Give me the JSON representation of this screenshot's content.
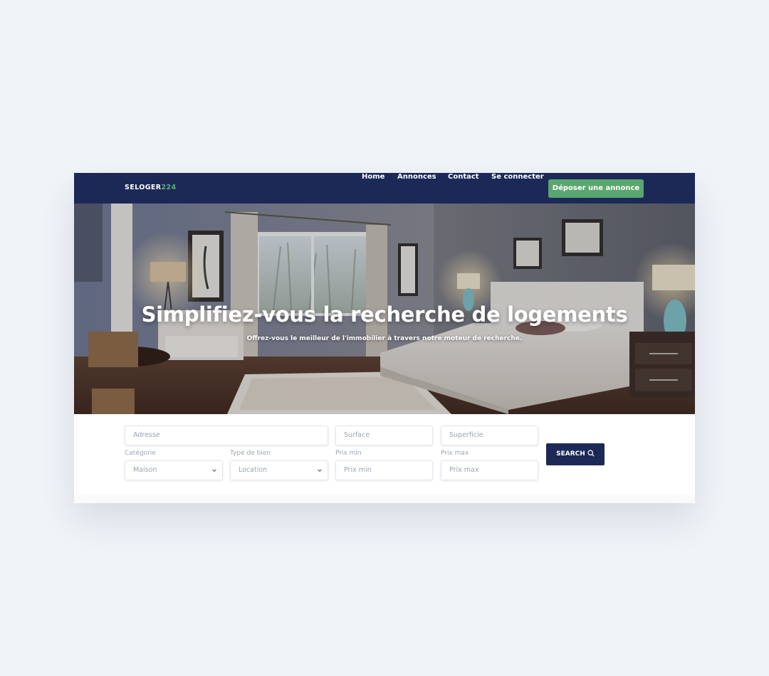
{
  "nav": {
    "logo_main": "SELOGER",
    "logo_accent": "224",
    "links": [
      "Home",
      "Annonces",
      "Contact",
      "Se connecter"
    ],
    "cta_label": "Déposer une annonce"
  },
  "hero": {
    "title": "Simplifiez-vous la recherche de logements",
    "subtitle": "Offrez-vous le meilleur de l'immobilier à travers notre moteur de recherche."
  },
  "search": {
    "address_placeholder": "Adresse",
    "surface_placeholder": "Surface",
    "superficie_placeholder": "Superficie",
    "category_label": "Catégorie",
    "category_value": "Maison",
    "type_label": "Type de bien",
    "type_value": "Location",
    "prix_min_label": "Prix min",
    "prix_min_placeholder": "Prix min",
    "prix_max_label": "Prix max",
    "prix_max_placeholder": "Prix max",
    "button_label": "SEARCH",
    "button_icon": "search-icon"
  },
  "colors": {
    "navy": "#1c2957",
    "green": "#5aa66f",
    "background": "#f0f4f8"
  }
}
